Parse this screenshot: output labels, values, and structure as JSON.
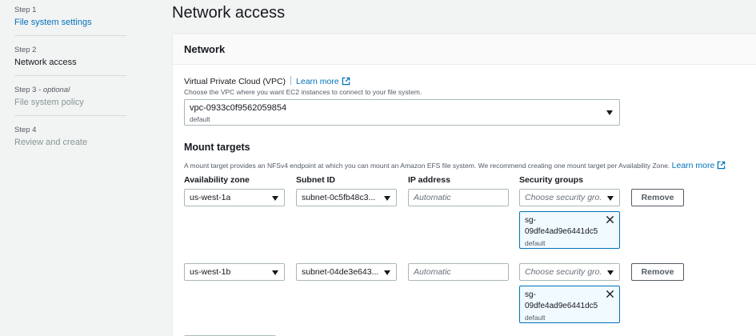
{
  "steps": [
    {
      "number": "Step 1",
      "label": "File system settings",
      "state": "link"
    },
    {
      "number": "Step 2",
      "label": "Network access",
      "state": "active"
    },
    {
      "number": "Step 3",
      "optional": "optional",
      "label": "File system policy",
      "state": "disabled"
    },
    {
      "number": "Step 4",
      "label": "Review and create",
      "state": "disabled"
    }
  ],
  "page_title": "Network access",
  "network": {
    "title": "Network",
    "vpc_label": "Virtual Private Cloud (VPC)",
    "learn_more": "Learn more",
    "vpc_description": "Choose the VPC where you want EC2 instances to connect to your file system.",
    "vpc_value": "vpc-0933c0f9562059854",
    "vpc_sub": "default"
  },
  "mount_targets": {
    "title": "Mount targets",
    "description": "A mount target provides an NFSv4 endpoint at which you can mount an Amazon EFS file system. We recommend creating one mount target per Availability Zone.",
    "learn_more": "Learn more",
    "columns": {
      "az": "Availability zone",
      "subnet": "Subnet ID",
      "ip": "IP address",
      "sg": "Security groups"
    },
    "rows": [
      {
        "az": "us-west-1a",
        "subnet": "subnet-0c5fb48c3...",
        "ip_placeholder": "Automatic",
        "sg_placeholder": "Choose security gro...",
        "token_value": "sg-09dfe4ad9e6441dc5",
        "token_sub": "default",
        "remove": "Remove"
      },
      {
        "az": "us-west-1b",
        "subnet": "subnet-04de3e643...",
        "ip_placeholder": "Automatic",
        "sg_placeholder": "Choose security gro...",
        "token_value": "sg-09dfe4ad9e6441dc5",
        "token_sub": "default",
        "remove": "Remove"
      }
    ]
  },
  "colors": {
    "link": "#0073bb",
    "text": "#16191f",
    "muted": "#545b64",
    "disabled": "#879596",
    "border": "#aab7b8",
    "token_bg": "#f1faff"
  },
  "icons": [
    "external-link-icon",
    "caret-down-icon",
    "close-icon"
  ]
}
